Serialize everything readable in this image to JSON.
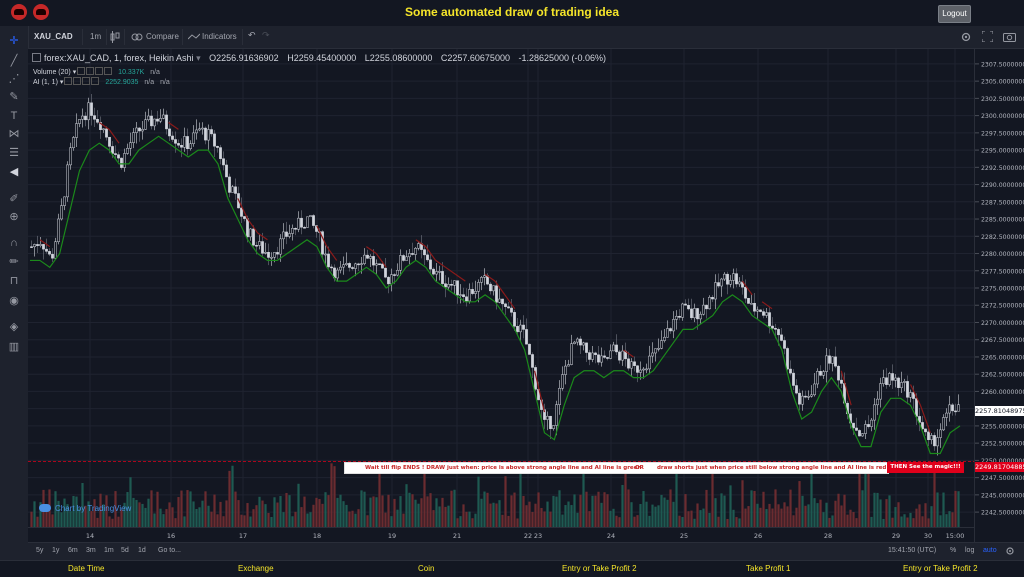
{
  "app": {
    "title": "Some automated draw of trading idea",
    "logout_label": "Logout"
  },
  "toolbar": {
    "symbol": "XAU_CAD",
    "interval": "1m",
    "compare": "Compare",
    "indicators": "Indicators"
  },
  "legend": {
    "main": "forex:XAU_CAD, 1, forex, Heikin Ashi",
    "o": "O2256.91636902",
    "h": "H2259.45400000",
    "l": "L2255.08600000",
    "c": "C2257.60675000",
    "chg": "-1.28625000 (-0.06%)",
    "volume_label": "Volume (20)",
    "volume_value": "10.337K",
    "volume_na": "n/a",
    "ai_label": "AI (1, 1)",
    "ai_value": "2252.9035",
    "ai_na1": "n/a",
    "ai_na2": "n/a"
  },
  "banner": {
    "part1": "Wait till flip ENDS  !   DRAW just when:  price is above strong angle line and AI line is green",
    "part2": "OR",
    "part3": "draw shorts just when price still below strong angle line and AI line is red",
    "magic": "THEN See the magic!!!"
  },
  "price_axis": {
    "labels": [
      "2307.50000000",
      "2305.00000000",
      "2302.50000000",
      "2300.00000000",
      "2297.50000000",
      "2295.00000000",
      "2292.50000000",
      "2290.00000000",
      "2287.50000000",
      "2285.00000000",
      "2282.50000000",
      "2280.00000000",
      "2277.50000000",
      "2275.00000000",
      "2272.50000000",
      "2270.00000000",
      "2267.50000000",
      "2265.00000000",
      "2262.50000000",
      "2260.00000000",
      "2257.50000000",
      "2255.00000000",
      "2252.50000000",
      "2250.00000000",
      "2247.50000000",
      "2245.00000000",
      "2242.50000000"
    ],
    "last_price": "2257.81048975",
    "level_price": "2249.81704885"
  },
  "time_axis": {
    "labels": [
      "14",
      "16",
      "17",
      "18",
      "19",
      "21",
      "22",
      "23",
      "24",
      "25",
      "26",
      "28",
      "29",
      "30",
      "15:00"
    ]
  },
  "bottom": {
    "ranges": [
      "5y",
      "1y",
      "6m",
      "3m",
      "1m",
      "5d",
      "1d"
    ],
    "goto": "Go to...",
    "clock": "15:41:50 (UTC)",
    "pct": "%",
    "log": "log",
    "auto": "auto"
  },
  "watermark": "Chart by TradingView",
  "footer": {
    "cols": [
      "Date Time",
      "Exchange",
      "Coin",
      "Entry or Take Profit 2",
      "Take Profit 1",
      "Entry or Take Profit 2"
    ]
  },
  "colors": {
    "up": "#26a69a",
    "down": "#ef5350",
    "ai_green": "#1b8a1b",
    "ai_red": "#8b1a1a",
    "candle_up": "#d1d4dc"
  },
  "chart_data": {
    "type": "candlestick",
    "ylim": [
      2241.5,
      2308.5
    ],
    "x_ticks": [
      "14",
      "16",
      "17",
      "18",
      "19",
      "21",
      "22",
      "23",
      "24",
      "25",
      "26",
      "28",
      "29",
      "30",
      "15:00"
    ],
    "close_path": [
      2281,
      2282,
      2279,
      2286,
      2295,
      2300,
      2301,
      2299,
      2296,
      2293,
      2296,
      2298,
      2299,
      2300,
      2298,
      2296,
      2296,
      2298,
      2297,
      2295,
      2290,
      2287,
      2283,
      2281,
      2280,
      2281,
      2283,
      2284,
      2285,
      2283,
      2279,
      2277,
      2278,
      2279,
      2280,
      2278,
      2276,
      2278,
      2280,
      2281,
      2279,
      2277,
      2276,
      2275,
      2274,
      2275,
      2276,
      2274,
      2272,
      2270,
      2268,
      2262,
      2255,
      2256,
      2263,
      2267,
      2266,
      2265,
      2264,
      2266,
      2265,
      2263,
      2264,
      2265,
      2267,
      2270,
      2272,
      2271,
      2272,
      2274,
      2276,
      2277,
      2275,
      2272,
      2272,
      2270,
      2268,
      2262,
      2258,
      2260,
      2263,
      2265,
      2262,
      2256,
      2254,
      2255,
      2261,
      2262,
      2261,
      2260,
      2256,
      2252,
      2254,
      2257,
      2258
    ],
    "ai_line": [
      2279,
      2279,
      2278,
      2280,
      2286,
      2292,
      2295,
      2296,
      2295,
      2293,
      2293,
      2295,
      2296,
      2297,
      2296,
      2295,
      2294,
      2295,
      2295,
      2293,
      2288,
      2285,
      2282,
      2280,
      2279,
      2279,
      2280,
      2281,
      2282,
      2281,
      2278,
      2276,
      2276,
      2277,
      2278,
      2277,
      2275,
      2276,
      2278,
      2279,
      2278,
      2276,
      2275,
      2274,
      2273,
      2273,
      2274,
      2273,
      2271,
      2269,
      2266,
      2260,
      2254,
      2253,
      2258,
      2262,
      2263,
      2263,
      2262,
      2263,
      2263,
      2262,
      2262,
      2263,
      2265,
      2267,
      2269,
      2269,
      2270,
      2271,
      2273,
      2274,
      2273,
      2271,
      2270,
      2269,
      2266,
      2260,
      2256,
      2257,
      2260,
      2262,
      2260,
      2255,
      2252,
      2252,
      2257,
      2259,
      2259,
      2258,
      2255,
      2251,
      2251,
      2254,
      2255
    ],
    "level_line": 2249.82,
    "last_price": 2257.81
  }
}
